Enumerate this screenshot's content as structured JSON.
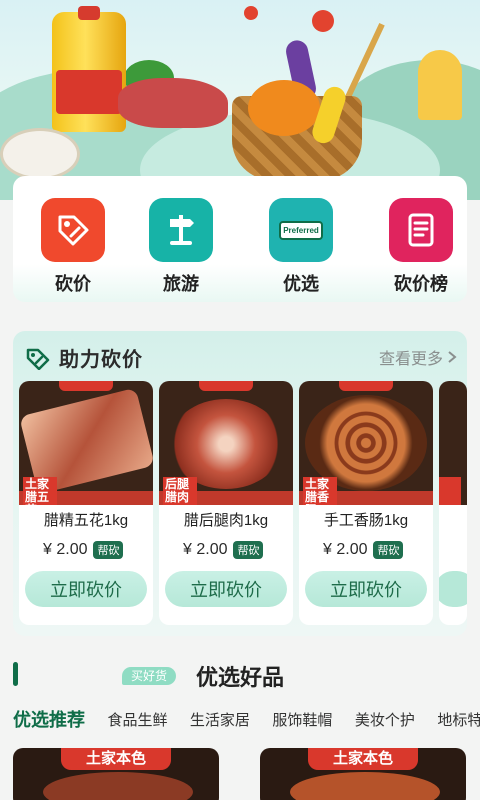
{
  "categories": [
    {
      "label": "砍价",
      "icon": "price-tag-icon",
      "color": "#f0492d"
    },
    {
      "label": "旅游",
      "icon": "signpost-icon",
      "color": "#17b3a7"
    },
    {
      "label": "优选",
      "icon": "preferred-sign-icon",
      "icon_text": "Preferred",
      "color": "#1fb3b0"
    },
    {
      "label": "砍价榜",
      "icon": "ranking-list-icon",
      "color": "#e0245e"
    }
  ],
  "assist": {
    "title": "助力砍价",
    "more_label": "查看更多",
    "products": [
      {
        "name": "腊精五花1kg",
        "price": "¥ 2.00",
        "badge": "帮砍",
        "button": "立即砍价",
        "tag": "土家腊五花"
      },
      {
        "name": "腊后腿肉1kg",
        "price": "¥ 2.00",
        "badge": "帮砍",
        "button": "立即砍价",
        "tag": "后腿腊肉"
      },
      {
        "name": "手工香肠1kg",
        "price": "¥ 2.00",
        "badge": "帮砍",
        "button": "立即砍价",
        "tag": "土家腊香肠"
      }
    ]
  },
  "selected": {
    "chip": "买好货",
    "title": "优选好品",
    "tabs": [
      "优选推荐",
      "食品生鲜",
      "生活家居",
      "服饰鞋帽",
      "美妆个护",
      "地标特"
    ],
    "cards": [
      {
        "header": "土家本色"
      },
      {
        "header": "土家本色"
      }
    ]
  },
  "colors": {
    "brand_green": "#0f6d48",
    "accent_red": "#d9382c"
  }
}
